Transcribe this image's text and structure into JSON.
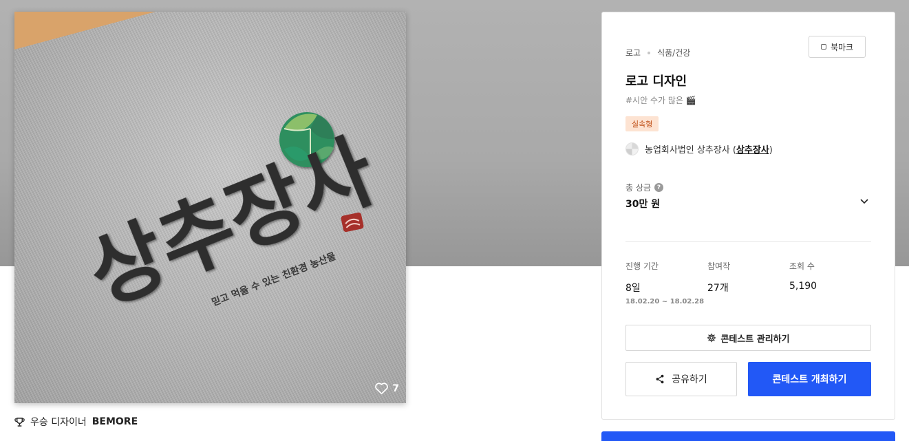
{
  "artwork": {
    "logo_text": "상추장사",
    "logo_slogan": "믿고 먹을 수 있는 친환경 농산물",
    "like_count": "7"
  },
  "winner": {
    "prefix": "우승 디자이너",
    "name": "BEMORE"
  },
  "card": {
    "breadcrumb": [
      "로고",
      "식품/건강"
    ],
    "bookmark_label": "북마크",
    "title": "로고 디자인",
    "tagline": "#시안 수가 많은 🎬",
    "type_badge": "실속형",
    "host_name": "농업회사법인 상추장사 (",
    "host_link": "상추장사",
    "host_suffix": ")",
    "prize_label": "총 상금",
    "prize_help": "?",
    "prize_value": "30만 원",
    "stats": [
      {
        "label": "진행 기간",
        "value": "8일",
        "sub": "18.02.20  ~  18.02.28"
      },
      {
        "label": "참여작",
        "value": "27개",
        "sub": ""
      },
      {
        "label": "조회 수",
        "value": "5,190",
        "sub": ""
      }
    ],
    "manage_label": "콘테스트 관리하기",
    "share_label": "공유하기",
    "host_contest_label": "콘테스트 개최하기"
  },
  "colors": {
    "primary": "#2258f6",
    "badge_bg": "#fde3d2",
    "badge_text": "#c04f16"
  }
}
